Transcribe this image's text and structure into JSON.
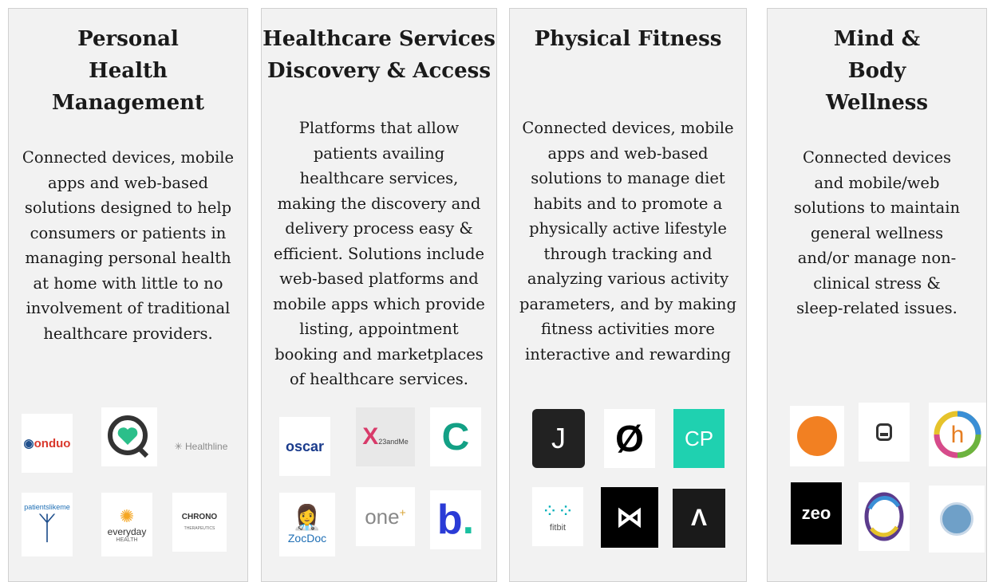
{
  "columns": [
    {
      "title": "Personal Health Management",
      "description": "Connected devices, mobile apps and web-based solutions designed to help consumers or patients in managing personal health at home with little to no involvement of traditional healthcare providers.",
      "logos": [
        {
          "name": "onduo",
          "text": "onduo",
          "color": "#d9382c"
        },
        {
          "name": "q-heart",
          "text": "",
          "color": "#2bbf8a"
        },
        {
          "name": "healthline",
          "text": "Healthline",
          "color": "#8a8a8a"
        },
        {
          "name": "patientslikeme",
          "text": "patientslikeme",
          "color": "#1f6fb5"
        },
        {
          "name": "everyday-health",
          "text": "everyday",
          "subtext": "HEALTH",
          "color": "#e84a2a"
        },
        {
          "name": "chrono",
          "text": "CHRONO",
          "subtext": "THERAPEUTICS",
          "color": "#333333"
        }
      ]
    },
    {
      "title": "Healthcare Services Discovery & Access",
      "description": "Platforms that allow patients availing healthcare services, making the discovery and delivery process easy & efficient. Solutions include web-based platforms and mobile apps which provide listing, appointment booking and marketplaces of  healthcare services.",
      "logos": [
        {
          "name": "oscar",
          "text": "oscar",
          "color": "#1a3b8c"
        },
        {
          "name": "23andme",
          "text": "23andMe",
          "color": "#d83b6a"
        },
        {
          "name": "c-logo",
          "text": "C",
          "color": "#13a085"
        },
        {
          "name": "zocdoc",
          "text": "ZocDoc",
          "color": "#1f6fb5"
        },
        {
          "name": "one-medical",
          "text": "one",
          "color": "#888888"
        },
        {
          "name": "b-logo",
          "text": "b.",
          "color": "#2a3bd6"
        }
      ]
    },
    {
      "title": "Physical Fitness",
      "description": "Connected devices, mobile apps and web-based solutions to manage diet habits and to promote a physically active lifestyle through tracking and analyzing various activity parameters, and by making fitness activities more interactive and rewarding",
      "logos": [
        {
          "name": "jawbone",
          "text": "J",
          "color": "#222222"
        },
        {
          "name": "peloton",
          "text": "Ø",
          "color": "#000000"
        },
        {
          "name": "cp-logo",
          "text": "CP",
          "color": "#1fd1b0"
        },
        {
          "name": "fitbit",
          "text": "fitbit",
          "color": "#00b0b9"
        },
        {
          "name": "mirror",
          "text": "⋈",
          "color": "#000000"
        },
        {
          "name": "a-logo",
          "text": "Λ",
          "color": "#1a1a1a"
        }
      ]
    },
    {
      "title": "Mind & Body Wellness",
      "description": "Connected devices and mobile/web solutions to maintain general wellness and/or manage non-clinical stress & sleep-related issues.",
      "logos": [
        {
          "name": "orange-circle",
          "text": "",
          "color": "#f28022"
        },
        {
          "name": "device-logo",
          "text": "",
          "color": "#333333"
        },
        {
          "name": "h-logo",
          "text": "h",
          "color": "#e67e22"
        },
        {
          "name": "zeo",
          "text": "zeo",
          "color": "#000000"
        },
        {
          "name": "swirl-logo",
          "text": "",
          "color": "#5b3b8c"
        },
        {
          "name": "badge-logo",
          "text": "",
          "color": "#6fa0c8"
        }
      ]
    }
  ]
}
